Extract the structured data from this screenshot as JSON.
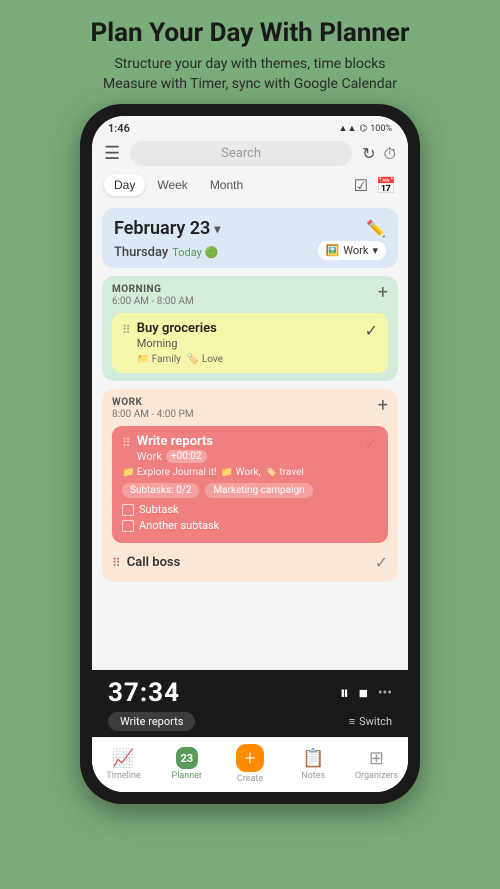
{
  "header": {
    "title": "Plan Your Day With Planner",
    "subtitle": "Structure your day with themes, time blocks\nMeasure with Timer, sync with Google Calendar"
  },
  "status_bar": {
    "time": "1:46",
    "battery": "100%",
    "signal_icons": "◀ ▲ ▲"
  },
  "search": {
    "placeholder": "Search"
  },
  "view_tabs": {
    "day": "Day",
    "week": "Week",
    "month": "Month"
  },
  "date_header": {
    "date": "February 23",
    "chevron": "▾",
    "day_name": "Thursday",
    "today_label": "Today",
    "work_theme": "Work",
    "work_icon": "🖼️"
  },
  "morning_section": {
    "title": "MORNING",
    "time_range": "6:00 AM - 8:00 AM",
    "task": {
      "title": "Buy groceries",
      "subtitle": "Morning",
      "tags": [
        "Family",
        "Love"
      ],
      "completed": true
    }
  },
  "work_section": {
    "title": "WORK",
    "time_range": "8:00 AM - 4:00 PM",
    "tasks": [
      {
        "title": "Write reports",
        "subtitle": "Work",
        "timer": "+00:02",
        "tags": [
          "Explore Journal it!",
          "Work",
          "travel"
        ],
        "subtask_count": "Subtasks: 0/2",
        "marketing": "Marketing campaign",
        "subtasks": [
          "Subtask",
          "Another subtask"
        ],
        "completed": true
      },
      {
        "title": "Call boss",
        "completed": false
      }
    ]
  },
  "timer_bar": {
    "time": "37:34",
    "task_label": "Write reports",
    "switch_label": "Switch",
    "pause_icon": "⏸",
    "stop_icon": "⏹",
    "more_icon": "•••"
  },
  "bottom_nav": {
    "items": [
      {
        "label": "Timeline",
        "icon": "📈",
        "active": false
      },
      {
        "label": "Planner",
        "badge": "23",
        "active": true
      },
      {
        "label": "Create",
        "icon": "+",
        "active": false
      },
      {
        "label": "Notes",
        "icon": "📋",
        "active": false
      },
      {
        "label": "Organizers",
        "icon": "▦",
        "active": false
      }
    ]
  }
}
